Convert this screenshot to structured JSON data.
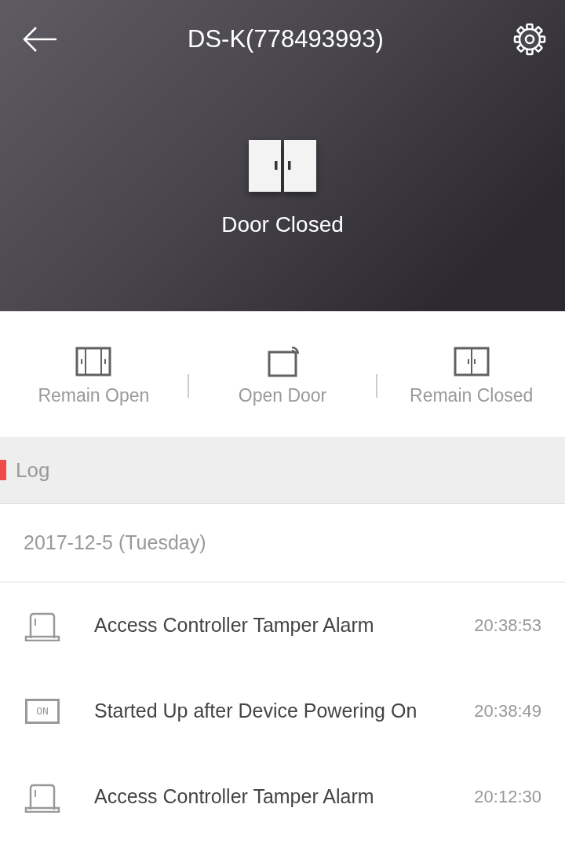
{
  "header": {
    "title": "DS-K(778493993)",
    "door_status": "Door Closed"
  },
  "actions": [
    {
      "kind": "remain_open",
      "label": "Remain Open"
    },
    {
      "kind": "open",
      "label": "Open Door"
    },
    {
      "kind": "remain_closed",
      "label": "Remain Closed"
    }
  ],
  "log": {
    "title": "Log",
    "date": "2017-12-5 (Tuesday)",
    "entries": [
      {
        "kind": "tamper",
        "text": "Access Controller Tamper Alarm",
        "time": "20:38:53"
      },
      {
        "kind": "power",
        "icon_text": "ON",
        "text": "Started Up after Device Powering On",
        "time": "20:38:49"
      },
      {
        "kind": "tamper",
        "text": "Access Controller Tamper Alarm",
        "time": "20:12:30"
      }
    ]
  }
}
